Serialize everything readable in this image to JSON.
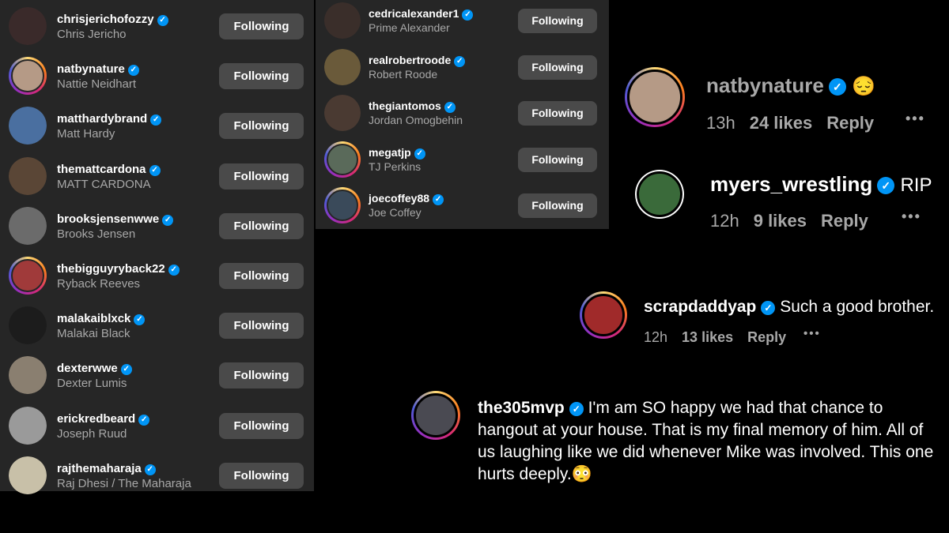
{
  "following_left": [
    {
      "username": "chrisjerichofozzy",
      "name": "Chris Jericho",
      "button": "Following",
      "avatar_color": "#3a2a2a",
      "ring": false
    },
    {
      "username": "natbynature",
      "name": "Nattie Neidhart",
      "button": "Following",
      "avatar_color": "#b59a86",
      "ring": true
    },
    {
      "username": "matthardybrand",
      "name": "Matt Hardy",
      "button": "Following",
      "avatar_color": "#4a6fa0",
      "ring": false
    },
    {
      "username": "themattcardona",
      "name": "MATT CARDONA",
      "button": "Following",
      "avatar_color": "#5a4636",
      "ring": false
    },
    {
      "username": "brooksjensenwwe",
      "name": "Brooks Jensen",
      "button": "Following",
      "avatar_color": "#6b6b6b",
      "ring": false
    },
    {
      "username": "thebigguyryback22",
      "name": "Ryback Reeves",
      "button": "Following",
      "avatar_color": "#a03a3a",
      "ring": true
    },
    {
      "username": "malakaiblxck",
      "name": "Malakai Black",
      "button": "Following",
      "avatar_color": "#1c1c1c",
      "ring": false
    },
    {
      "username": "dexterwwe",
      "name": "Dexter Lumis",
      "button": "Following",
      "avatar_color": "#8a7f70",
      "ring": false
    },
    {
      "username": "erickredbeard",
      "name": "Joseph Ruud",
      "button": "Following",
      "avatar_color": "#9a9a9a",
      "ring": false
    },
    {
      "username": "rajthemaharaja",
      "name": "Raj Dhesi / The Maharaja",
      "button": "Following",
      "avatar_color": "#c8c0a8",
      "ring": false
    }
  ],
  "following_mid": [
    {
      "username": "cedricalexander1",
      "name": "Prime Alexander",
      "button": "Following",
      "avatar_color": "#3a2e2a",
      "ring": false
    },
    {
      "username": "realrobertroode",
      "name": "Robert Roode",
      "button": "Following",
      "avatar_color": "#6a5a3a",
      "ring": false
    },
    {
      "username": "thegiantomos",
      "name": "Jordan Omogbehin",
      "button": "Following",
      "avatar_color": "#4a3a32",
      "ring": false
    },
    {
      "username": "megatjp",
      "name": "TJ Perkins",
      "button": "Following",
      "avatar_color": "#5a6a5a",
      "ring": true
    },
    {
      "username": "joecoffey88",
      "name": "Joe Coffey",
      "button": "Following",
      "avatar_color": "#3a4a5a",
      "ring": true
    }
  ],
  "comments": [
    {
      "username": "natbynature",
      "text": "😔",
      "time": "13h",
      "likes": "24 likes",
      "reply": "Reply",
      "avatar_color": "#b59a86"
    },
    {
      "username": "myers_wrestling",
      "text": "RIP",
      "time": "12h",
      "likes": "9 likes",
      "reply": "Reply",
      "avatar_color": "#3a6a3a"
    },
    {
      "username": "scrapdaddyap",
      "text": "Such a good brother.",
      "time": "12h",
      "likes": "13 likes",
      "reply": "Reply",
      "avatar_color": "#a02a2a"
    },
    {
      "username": "the305mvp",
      "text": "I'm am SO happy we had that chance to",
      "line2": "hangout at your house. That is my final memory of him. All of",
      "line3": "us laughing like we did whenever Mike was involved. This one",
      "line4": "hurts deeply.😳",
      "avatar_color": "#4a4a52"
    }
  ],
  "icons": {
    "verified": "verified-badge-icon",
    "more": "more-options-icon"
  },
  "colors": {
    "verified": "#0095f6",
    "panel": "#262626",
    "button": "#4a4a4a",
    "muted": "#a8a8a8"
  },
  "verified_mark": "✓",
  "more_mark": "•••"
}
